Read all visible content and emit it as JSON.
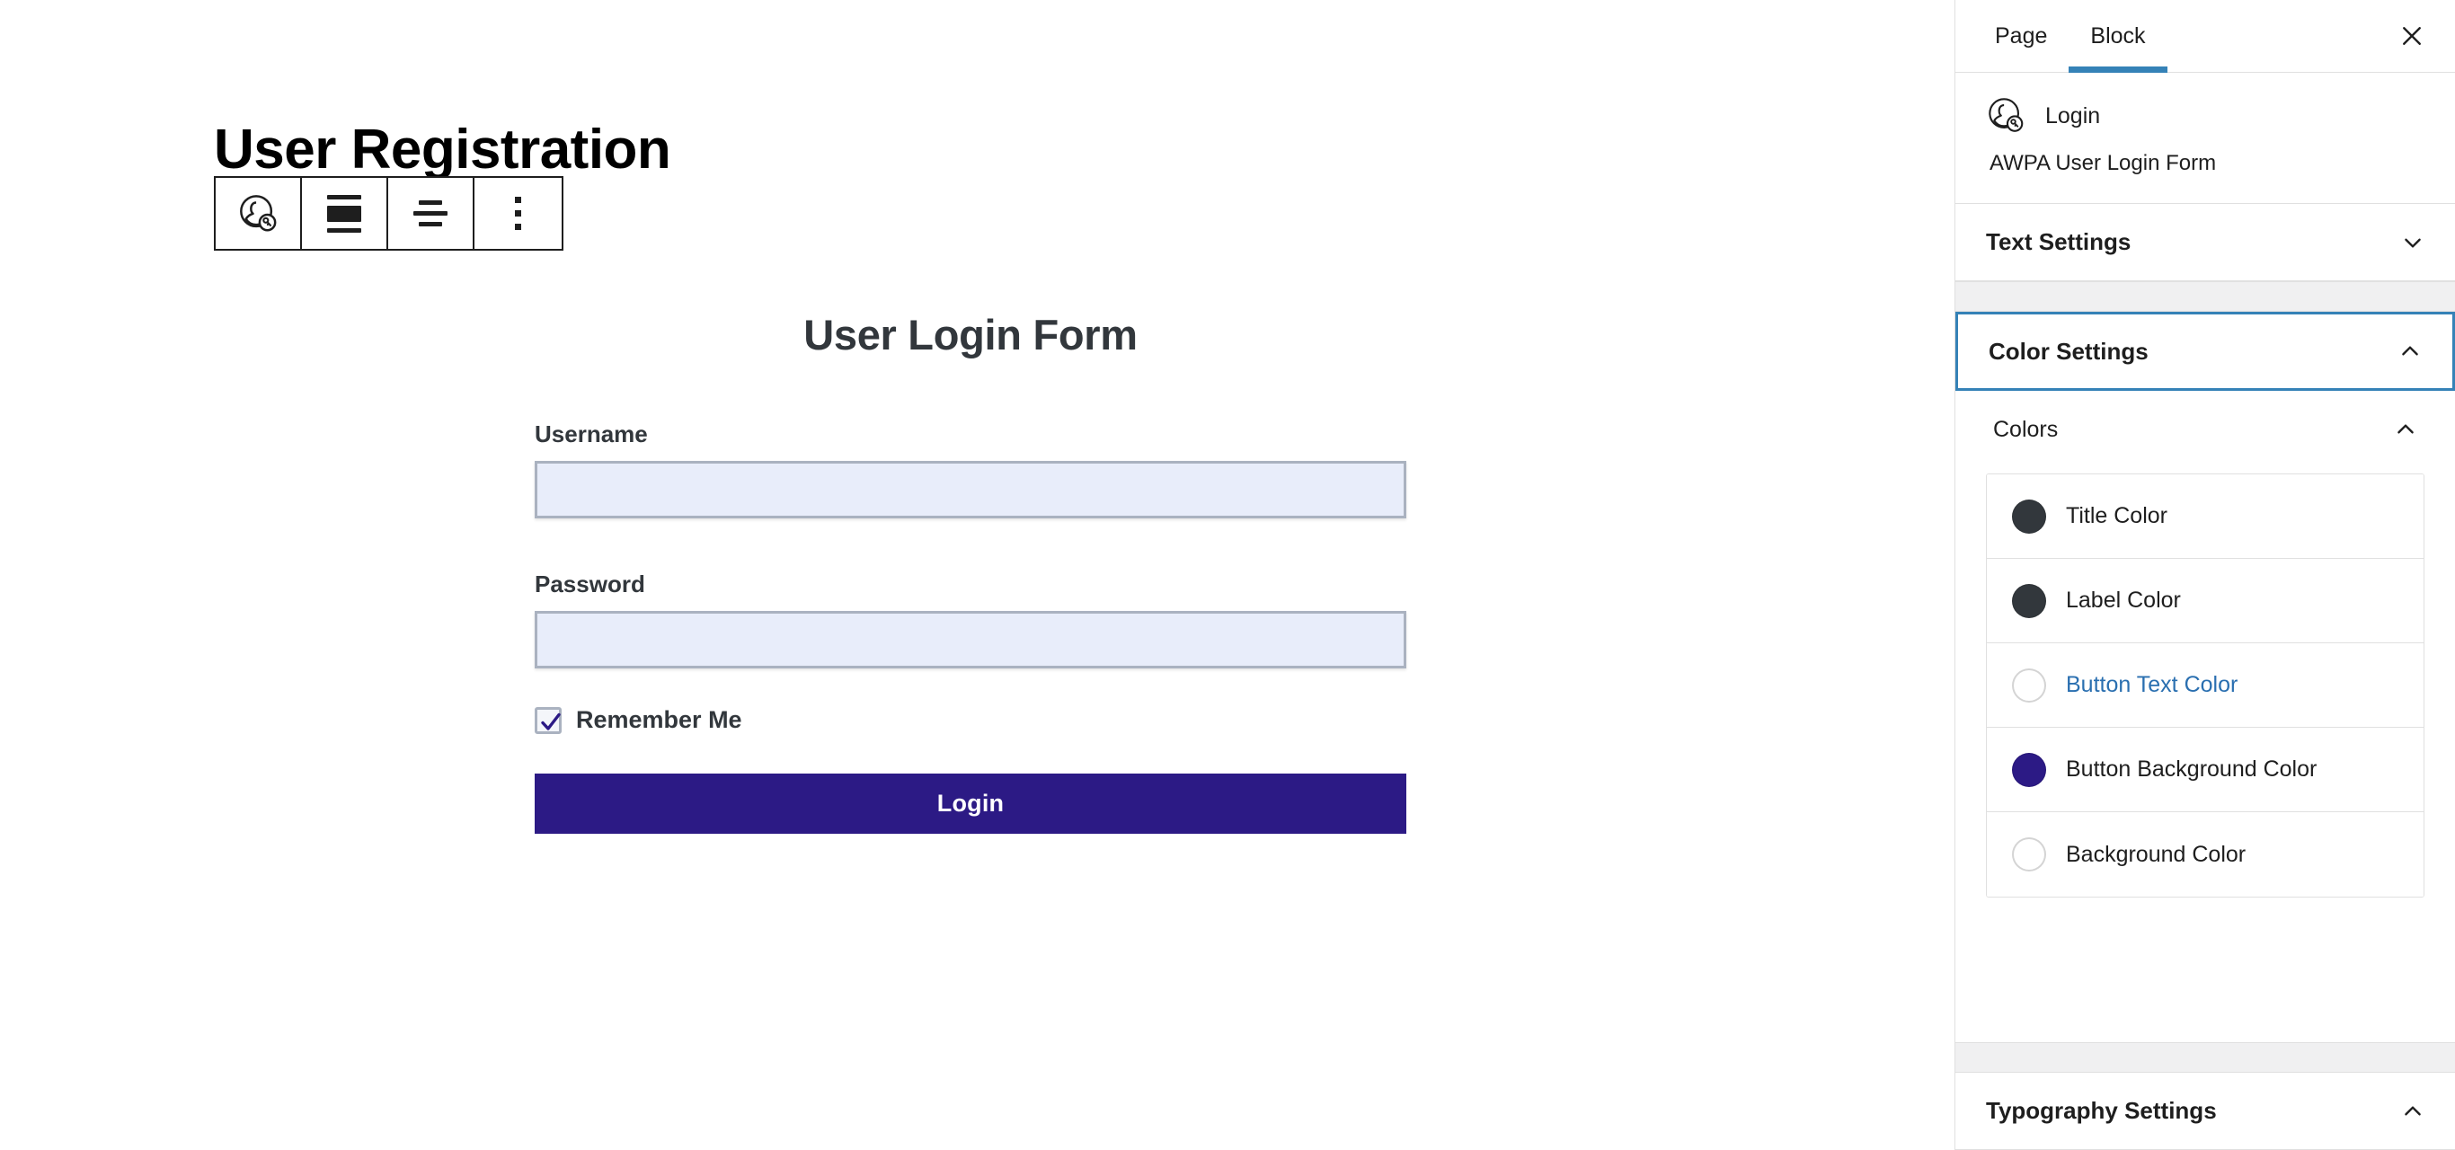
{
  "canvas": {
    "page_title": "User Registration",
    "toolbar": {
      "items": [
        {
          "name": "login-block-icon",
          "label": "Login block"
        },
        {
          "name": "block-align-center-icon",
          "label": "Align center"
        },
        {
          "name": "text-align-center-icon",
          "label": "Change text alignment"
        },
        {
          "name": "more-options-icon",
          "label": "Options"
        }
      ]
    },
    "form": {
      "title": "User Login Form",
      "username_label": "Username",
      "username_value": "",
      "username_placeholder": "",
      "password_label": "Password",
      "password_value": "",
      "password_placeholder": "",
      "remember_label": "Remember Me",
      "remember_checked": true,
      "submit_label": "Login"
    }
  },
  "sidebar": {
    "tabs": [
      {
        "label": "Page",
        "active": false
      },
      {
        "label": "Block",
        "active": true
      }
    ],
    "close_label": "Close settings",
    "block": {
      "title": "Login",
      "description": "AWPA User Login Form",
      "icon": "login-user-key-icon"
    },
    "panels": [
      {
        "label": "Text Settings",
        "expanded": false
      },
      {
        "label": "Color Settings",
        "expanded": true,
        "focused": true
      },
      {
        "label": "Typography Settings",
        "expanded": true
      }
    ],
    "colors_section": {
      "label": "Colors",
      "expanded": true,
      "items": [
        {
          "label": "Title Color",
          "value": "#32373c",
          "empty": false,
          "link": false
        },
        {
          "label": "Label Color",
          "value": "#32373c",
          "empty": false,
          "link": false
        },
        {
          "label": "Button Text Color",
          "value": "",
          "empty": true,
          "link": true
        },
        {
          "label": "Button Background Color",
          "value": "#2c1a85",
          "empty": false,
          "link": false
        },
        {
          "label": "Background Color",
          "value": "",
          "empty": true,
          "link": false
        }
      ]
    }
  },
  "theme": {
    "accent_blue": "#3582b7",
    "link_blue": "#2a6fb0",
    "button_indigo": "#2c1a85",
    "text_dark": "#1e1e1e",
    "form_text": "#32373c",
    "input_bg": "#e8edfa",
    "input_border": "#aab2c0",
    "panel_divider": "#e0e0e0",
    "band_gray": "#f0f0f1"
  }
}
